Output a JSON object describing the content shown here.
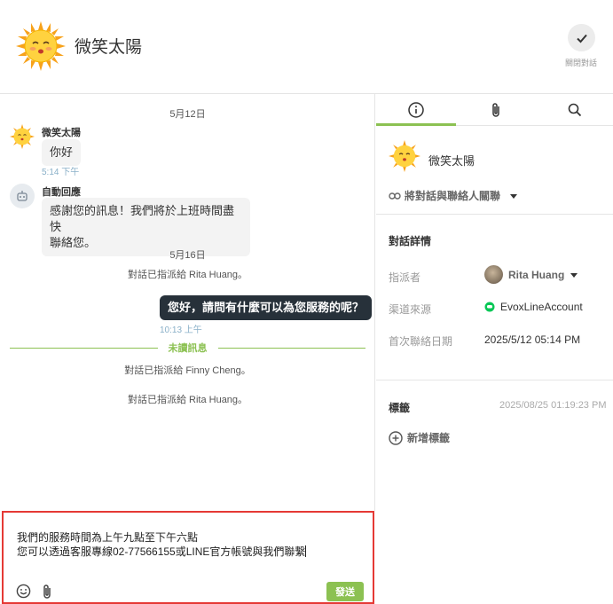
{
  "header": {
    "title": "微笑太陽",
    "close_label": "關閉對話"
  },
  "chat": {
    "date1": "5月12日",
    "user_name": "微笑太陽",
    "user_msg": "你好",
    "user_time": "5:14 下午",
    "bot_name": "自動回應",
    "bot_msg_line1": "感謝您的訊息！我們將於上班時間盡快",
    "bot_msg_line2": "聯絡您。",
    "date2": "5月16日",
    "sys1": "對話已指派給 Rita Huang。",
    "agent_msg": "您好，請問有什麼可以為您服務的呢？",
    "agent_time": "10:13 上午",
    "unread_label": "未讀訊息",
    "sys2": "對話已指派給 Finny Cheng。",
    "sys3": "對話已指派給 Rita Huang。"
  },
  "composer": {
    "line1": "我們的服務時間為上午九點至下午六點",
    "line2": "您可以透過客服專線02-77566155或LINE官方帳號與我們聯繫",
    "send_label": "發送"
  },
  "panel": {
    "contact_name": "微笑太陽",
    "link_contact_label": "將對話與聯絡人關聯",
    "details_title": "對話詳情",
    "assignee_key": "指派者",
    "assignee_value": "Rita Huang",
    "source_key": "渠道來源",
    "source_value": "EvoxLineAccount",
    "first_contact_key": "首次聯絡日期",
    "first_contact_value": "2025/5/12 05:14 PM",
    "tags_title": "標籤",
    "tags_time": "2025/08/25 01:19:23 PM",
    "add_tag_label": "新增標籤"
  },
  "colors": {
    "accent_green": "#8cc152",
    "agent_bubble": "#27313a",
    "highlight_border": "#e53935"
  },
  "icons": [
    "sun-avatar",
    "check-icon",
    "robot-icon",
    "smiley-icon",
    "paperclip-icon",
    "info-icon",
    "search-icon",
    "link-icon",
    "caret-down-icon",
    "line-icon",
    "plus-circle-icon"
  ]
}
